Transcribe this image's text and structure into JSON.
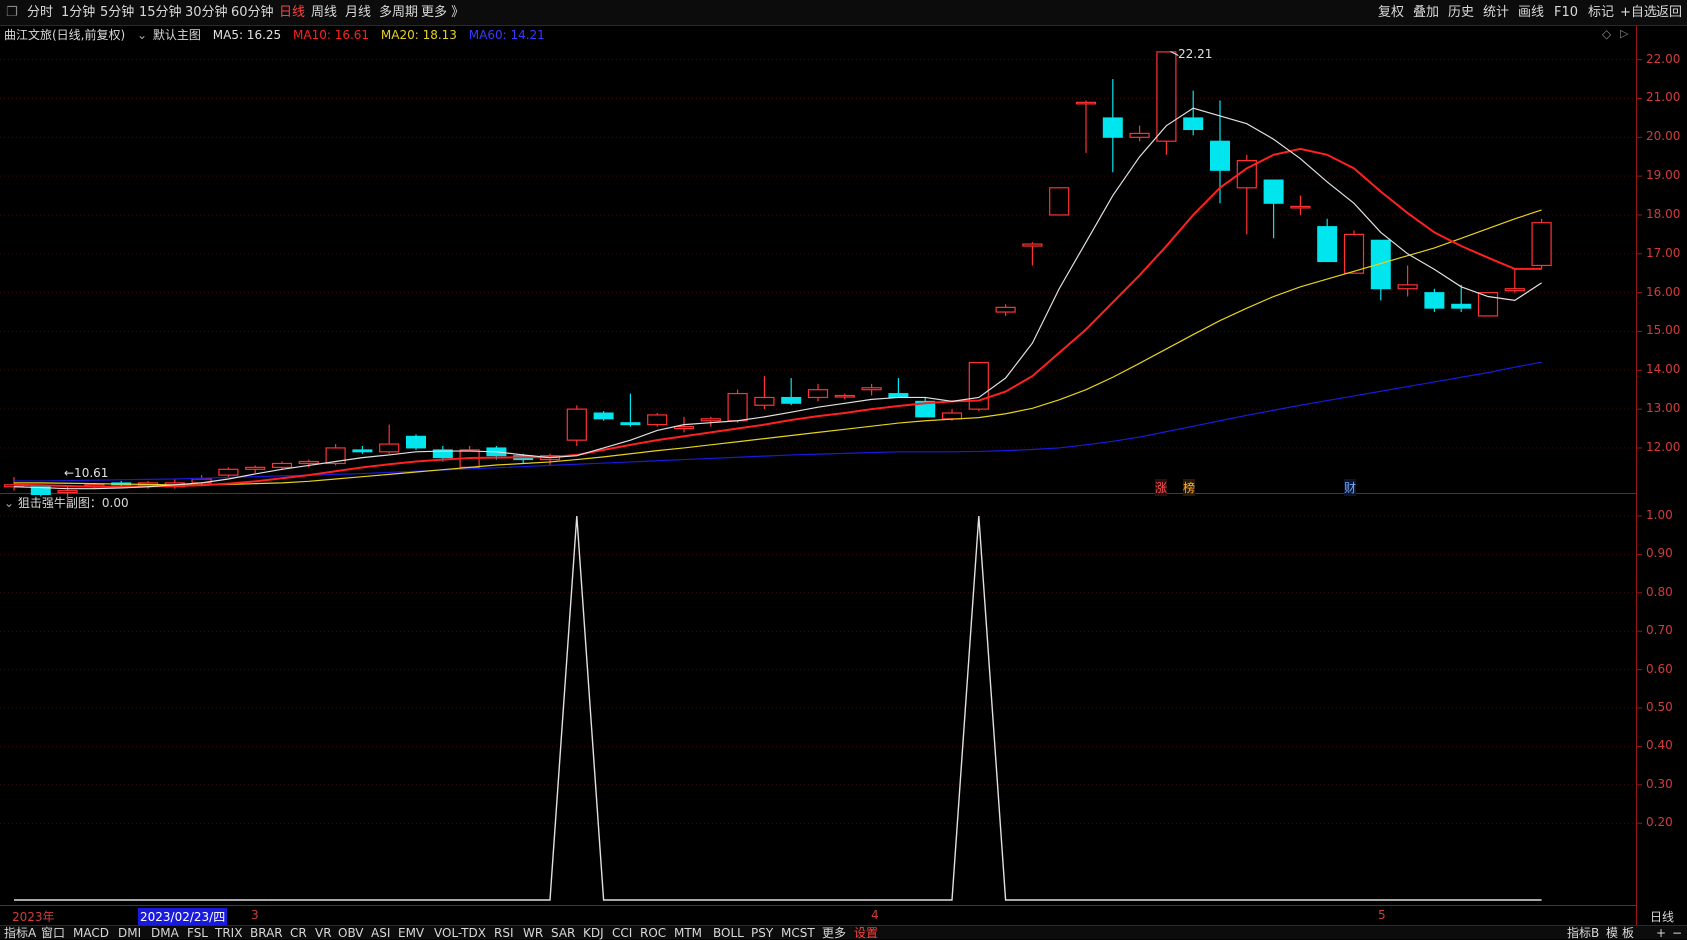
{
  "topbar": {
    "menus": [
      "分时",
      "1分钟",
      "5分钟",
      "15分钟",
      "30分钟",
      "60分钟",
      "日线",
      "周线",
      "月线",
      "多周期",
      "更多 》"
    ],
    "active": "日线",
    "right_buttons": [
      "复权",
      "叠加",
      "历史",
      "统计",
      "画线",
      "F10",
      "标记",
      "+自选",
      "返回"
    ]
  },
  "info": {
    "title": "曲江文旅(日线,前复权)",
    "main_chart": "默认主图",
    "ma5": "MA5: 16.25",
    "ma10": "MA10: 16.61",
    "ma20": "MA20: 18.13",
    "ma60": "MA60: 14.21"
  },
  "colors": {
    "up": "#ff3232",
    "down": "#00e5ee",
    "ma5": "#e0e0e0",
    "ma10": "#ff2020",
    "ma20": "#e6d21e",
    "ma60": "#1a1adc",
    "axis": "#9b1515",
    "indicator": "#e0e0e0"
  },
  "main_axis": {
    "ticks": [
      "22.00",
      "21.00",
      "20.00",
      "19.00",
      "18.00",
      "17.00",
      "16.00",
      "15.00",
      "14.00",
      "13.00",
      "12.00"
    ],
    "ymin": 11.2,
    "ymax": 22.3
  },
  "sub_axis": {
    "ticks": [
      "1.00",
      "0.90",
      "0.80",
      "0.70",
      "0.60",
      "0.50",
      "0.40",
      "0.30",
      "0.20"
    ],
    "ymin": 0,
    "ymax": 1
  },
  "annotations": {
    "high": "22.21",
    "low": "←10.61",
    "markers": [
      "涨",
      "榜",
      "财"
    ]
  },
  "sub_title": "狙击强牛副图：0.00",
  "dates": {
    "year": "2023年",
    "cursor": "2023/02/23/四",
    "months": [
      "3",
      "4",
      "5"
    ]
  },
  "bottombar": {
    "left": [
      "指标A",
      "窗口",
      "MACD",
      "DMI",
      "DMA",
      "FSL",
      "TRIX",
      "BRAR",
      "CR",
      "VR",
      "OBV",
      "ASI",
      "EMV",
      "VOL-TDX",
      "RSI",
      "WR",
      "SAR",
      "KDJ",
      "CCI",
      "ROC",
      "MTM",
      "BOLL",
      "PSY",
      "MCST",
      "更多",
      "设置"
    ],
    "right": [
      "指标B",
      "模",
      "板",
      "+",
      "−"
    ],
    "period": "日线"
  },
  "chart_data": {
    "type": "candlestick",
    "candles": [
      [
        11.0,
        11.25,
        10.9,
        11.05
      ],
      [
        11.0,
        11.0,
        10.75,
        10.8
      ],
      [
        10.85,
        11.0,
        10.61,
        10.9
      ],
      [
        11.0,
        11.1,
        10.95,
        11.05
      ],
      [
        11.1,
        11.15,
        11.0,
        11.05
      ],
      [
        11.05,
        11.15,
        10.95,
        11.1
      ],
      [
        11.0,
        11.2,
        10.95,
        11.1
      ],
      [
        11.1,
        11.3,
        11.05,
        11.2
      ],
      [
        11.3,
        11.5,
        11.25,
        11.45
      ],
      [
        11.45,
        11.55,
        11.35,
        11.5
      ],
      [
        11.5,
        11.65,
        11.45,
        11.6
      ],
      [
        11.6,
        11.7,
        11.5,
        11.65
      ],
      [
        11.6,
        12.1,
        11.55,
        12.0
      ],
      [
        11.95,
        12.05,
        11.85,
        11.9
      ],
      [
        11.9,
        12.6,
        11.85,
        12.1
      ],
      [
        12.3,
        12.35,
        11.95,
        12.0
      ],
      [
        11.95,
        12.05,
        11.65,
        11.75
      ],
      [
        11.5,
        12.05,
        11.45,
        11.95
      ],
      [
        12.0,
        12.05,
        11.7,
        11.8
      ],
      [
        11.8,
        11.85,
        11.6,
        11.7
      ],
      [
        11.7,
        11.85,
        11.55,
        11.8
      ],
      [
        12.2,
        13.1,
        12.05,
        13.0
      ],
      [
        12.9,
        12.95,
        12.7,
        12.75
      ],
      [
        12.65,
        13.4,
        12.55,
        12.6
      ],
      [
        12.6,
        12.9,
        12.55,
        12.85
      ],
      [
        12.5,
        12.8,
        12.4,
        12.55
      ],
      [
        12.7,
        12.8,
        12.55,
        12.75
      ],
      [
        12.7,
        13.5,
        12.65,
        13.4
      ],
      [
        13.1,
        13.85,
        13.0,
        13.3
      ],
      [
        13.3,
        13.8,
        13.1,
        13.15
      ],
      [
        13.3,
        13.65,
        13.2,
        13.5
      ],
      [
        13.35,
        13.4,
        13.25,
        13.35
      ],
      [
        13.5,
        13.65,
        13.35,
        13.55
      ],
      [
        13.4,
        13.8,
        13.3,
        13.3
      ],
      [
        13.2,
        13.3,
        12.8,
        12.8
      ],
      [
        12.75,
        13.0,
        12.7,
        12.9
      ],
      [
        13.0,
        14.2,
        12.95,
        14.2
      ],
      [
        15.5,
        15.7,
        15.4,
        15.62
      ],
      [
        17.2,
        17.3,
        16.7,
        17.25
      ],
      [
        18.0,
        18.7,
        18.0,
        18.7
      ],
      [
        20.9,
        20.95,
        19.6,
        20.9
      ],
      [
        20.5,
        21.5,
        19.1,
        20.0
      ],
      [
        20.0,
        20.3,
        19.9,
        20.1
      ],
      [
        19.9,
        22.21,
        19.55,
        22.2
      ],
      [
        20.5,
        21.2,
        20.05,
        20.2
      ],
      [
        19.9,
        20.95,
        18.3,
        19.15
      ],
      [
        18.7,
        19.55,
        17.5,
        19.4
      ],
      [
        18.9,
        18.9,
        17.4,
        18.3
      ],
      [
        18.2,
        18.5,
        18.0,
        18.22
      ],
      [
        17.7,
        17.9,
        16.8,
        16.8
      ],
      [
        16.5,
        17.6,
        16.5,
        17.5
      ],
      [
        17.35,
        17.35,
        15.8,
        16.1
      ],
      [
        16.1,
        16.7,
        15.9,
        16.2
      ],
      [
        16.0,
        16.1,
        15.5,
        15.6
      ],
      [
        15.7,
        16.2,
        15.5,
        15.6
      ],
      [
        15.4,
        16.0,
        15.4,
        16.0
      ],
      [
        16.05,
        16.6,
        16.0,
        16.1
      ],
      [
        16.7,
        17.9,
        16.6,
        17.8
      ]
    ],
    "ma5": [
      11.0,
      10.98,
      10.95,
      10.95,
      10.97,
      11.0,
      11.05,
      11.1,
      11.2,
      11.33,
      11.45,
      11.55,
      11.65,
      11.75,
      11.82,
      11.9,
      11.92,
      11.92,
      11.9,
      11.82,
      11.75,
      11.8,
      12.0,
      12.2,
      12.45,
      12.6,
      12.65,
      12.7,
      12.8,
      12.92,
      13.05,
      13.15,
      13.25,
      13.3,
      13.3,
      13.2,
      13.3,
      13.8,
      14.7,
      16.1,
      17.3,
      18.5,
      19.5,
      20.3,
      20.75,
      20.55,
      20.35,
      19.95,
      19.45,
      18.85,
      18.3,
      17.55,
      17.0,
      16.6,
      16.15,
      15.9,
      15.8,
      16.25
    ],
    "ma10": [
      11.05,
      11.04,
      11.02,
      11.0,
      11.0,
      11.01,
      11.02,
      11.04,
      11.08,
      11.14,
      11.22,
      11.3,
      11.4,
      11.5,
      11.58,
      11.65,
      11.7,
      11.74,
      11.75,
      11.76,
      11.76,
      11.82,
      11.95,
      12.08,
      12.2,
      12.3,
      12.4,
      12.5,
      12.6,
      12.72,
      12.82,
      12.9,
      13.0,
      13.08,
      13.15,
      13.2,
      13.22,
      13.45,
      13.85,
      14.45,
      15.05,
      15.75,
      16.45,
      17.2,
      18.0,
      18.7,
      19.2,
      19.55,
      19.7,
      19.55,
      19.2,
      18.6,
      18.05,
      17.55,
      17.2,
      16.9,
      16.61,
      16.61
    ],
    "ma20": [
      11.1,
      11.1,
      11.09,
      11.08,
      11.07,
      11.06,
      11.05,
      11.05,
      11.06,
      11.08,
      11.1,
      11.14,
      11.2,
      11.26,
      11.32,
      11.38,
      11.44,
      11.5,
      11.56,
      11.6,
      11.64,
      11.7,
      11.77,
      11.85,
      11.93,
      12.0,
      12.08,
      12.16,
      12.24,
      12.32,
      12.4,
      12.48,
      12.56,
      12.64,
      12.7,
      12.74,
      12.78,
      12.88,
      13.02,
      13.24,
      13.5,
      13.82,
      14.18,
      14.55,
      14.92,
      15.28,
      15.6,
      15.9,
      16.15,
      16.35,
      16.55,
      16.75,
      16.95,
      17.15,
      17.4,
      17.65,
      17.9,
      18.13
    ],
    "ma60": [
      11.15,
      11.15,
      11.16,
      11.17,
      11.18,
      11.19,
      11.2,
      11.22,
      11.24,
      11.26,
      11.28,
      11.3,
      11.32,
      11.34,
      11.37,
      11.4,
      11.43,
      11.46,
      11.49,
      11.52,
      11.55,
      11.58,
      11.61,
      11.64,
      11.67,
      11.7,
      11.73,
      11.76,
      11.79,
      11.82,
      11.84,
      11.86,
      11.88,
      11.9,
      11.9,
      11.9,
      11.91,
      11.93,
      11.96,
      12.0,
      12.08,
      12.17,
      12.28,
      12.42,
      12.56,
      12.7,
      12.84,
      12.97,
      13.1,
      13.22,
      13.34,
      13.46,
      13.58,
      13.7,
      13.82,
      13.94,
      14.08,
      14.21
    ],
    "indicator": [
      0,
      0,
      0,
      0,
      0,
      0,
      0,
      0,
      0,
      0,
      0,
      0,
      0,
      0,
      0,
      0,
      0,
      0,
      0,
      0,
      0,
      1,
      0,
      0,
      0,
      0,
      0,
      0,
      0,
      0,
      0,
      0,
      0,
      0,
      0,
      0,
      1,
      0,
      0,
      0,
      0,
      0,
      0,
      0,
      0,
      0,
      0,
      0,
      0,
      0,
      0,
      0,
      0,
      0,
      0,
      0,
      0,
      0
    ]
  }
}
